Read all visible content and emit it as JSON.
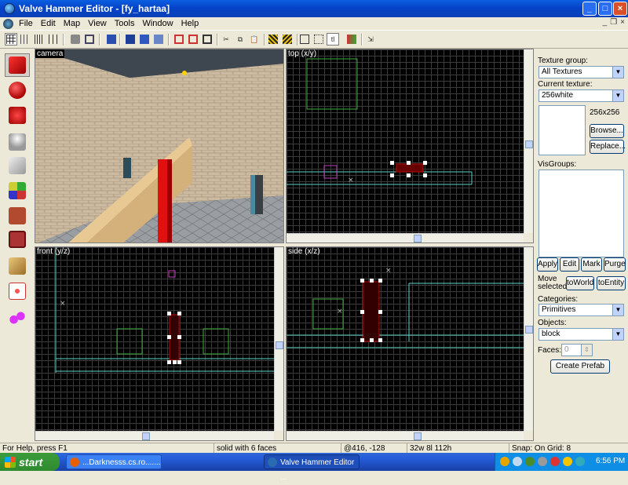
{
  "window": {
    "title": "Valve Hammer Editor - [fy_hartaa]",
    "controls": {
      "minimize": "_",
      "maximize": "□",
      "close": "×"
    }
  },
  "menu": {
    "items": [
      "File",
      "Edit",
      "Map",
      "View",
      "Tools",
      "Window",
      "Help"
    ],
    "mdi_controls": {
      "minimize": "_",
      "restore": "❐",
      "close": "×"
    }
  },
  "viewports": {
    "camera": {
      "label": "camera"
    },
    "top": {
      "label": "top (x/y)"
    },
    "front": {
      "label": "front (y/z)"
    },
    "side": {
      "label": "side (x/z)"
    }
  },
  "right_panel": {
    "texture_group_label": "Texture group:",
    "texture_group_value": "All Textures",
    "current_texture_label": "Current texture:",
    "current_texture_value": "256white",
    "texture_size": "256x256",
    "browse_button": "Browse...",
    "replace_button": "Replace...",
    "visgroups_label": "VisGroups:",
    "apply_button": "Apply",
    "edit_button": "Edit",
    "mark_button": "Mark",
    "purge_button": "Purge",
    "move_selected_label_1": "Move",
    "move_selected_label_2": "selected:",
    "to_world_button": "toWorld",
    "to_entity_button": "toEntity",
    "categories_label": "Categories:",
    "categories_value": "Primitives",
    "objects_label": "Objects:",
    "objects_value": "block",
    "faces_label": "Faces:",
    "faces_value": "0",
    "create_prefab_button": "Create Prefab"
  },
  "status_bar": {
    "help": "For Help, press F1",
    "selection": "solid with 6 faces",
    "coords": "@416, -128",
    "size": "32w 8l 112h",
    "snap": "Snap: On Grid: 8"
  },
  "taskbar": {
    "start": "start",
    "tasks": [
      {
        "label": "...Darknesss.cs.ro......."
      },
      {
        "label": "Valve Hammer Editor ..."
      }
    ],
    "clock": "6:56 PM"
  },
  "colors": {
    "xp_blue": "#0543c8",
    "viewport_bg": "#000000",
    "selection_red": "#c00000",
    "brush_green": "#3fae3f",
    "entity_cyan": "#5fd0c8"
  }
}
